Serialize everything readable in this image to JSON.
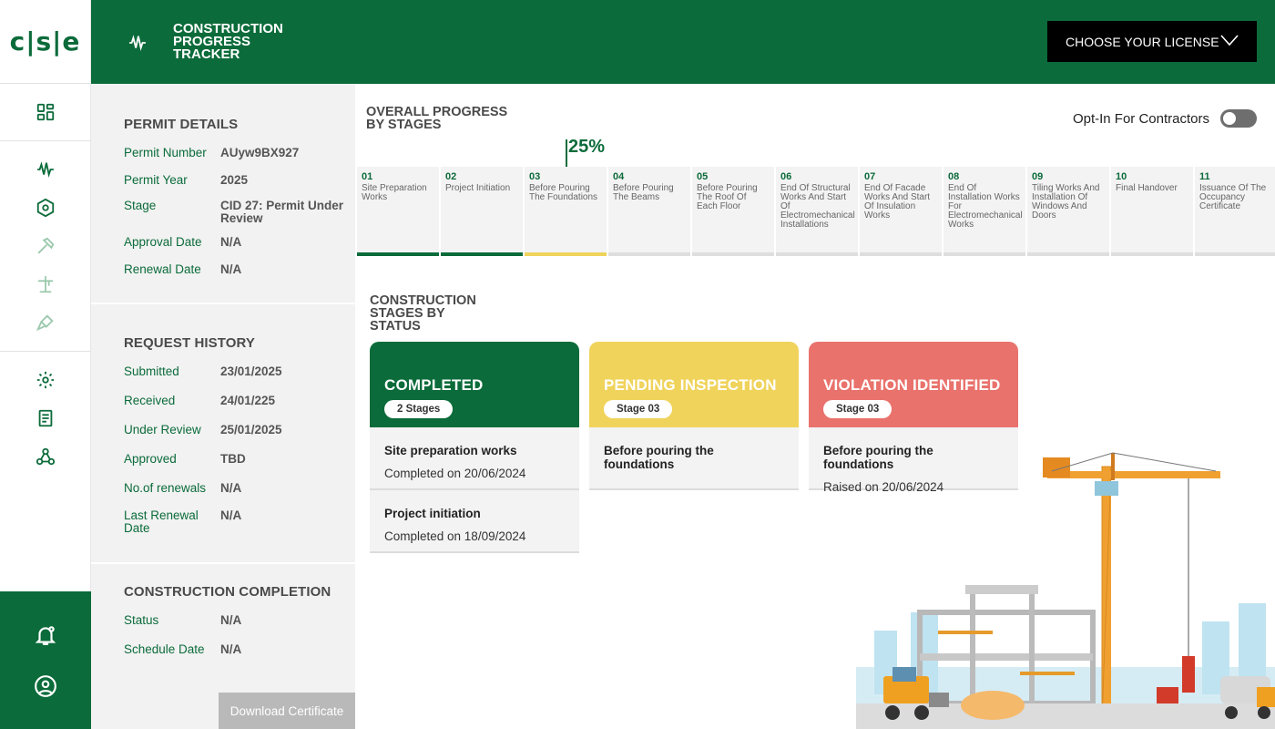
{
  "logo": {
    "text": "c|s|e"
  },
  "header": {
    "title": "CONSTRUCTION PROGRESS TRACKER",
    "license_button": "CHOOSE YOUR LICENSE"
  },
  "permit": {
    "title": "PERMIT DETAILS",
    "rows": [
      {
        "label": "Permit Number",
        "value": "AUyw9BX927"
      },
      {
        "label": "Permit Year",
        "value": "2025"
      },
      {
        "label": "Stage",
        "value": "CID 27: Permit Under Review"
      },
      {
        "label": "Approval Date",
        "value": "N/A"
      },
      {
        "label": "Renewal Date",
        "value": "N/A"
      }
    ]
  },
  "history": {
    "title": "REQUEST HISTORY",
    "rows": [
      {
        "label": "Submitted",
        "value": "23/01/2025"
      },
      {
        "label": "Received",
        "value": "24/01/225"
      },
      {
        "label": "Under Review",
        "value": "25/01/2025"
      },
      {
        "label": "Approved",
        "value": "TBD"
      },
      {
        "label": "No.of renewals",
        "value": "N/A"
      },
      {
        "label": "Last Renewal Date",
        "value": "N/A"
      }
    ]
  },
  "completion": {
    "title": "CONSTRUCTION COMPLETION",
    "rows": [
      {
        "label": "Status",
        "value": "N/A"
      },
      {
        "label": "Schedule Date",
        "value": "N/A"
      }
    ],
    "download_button": "Download Certificate"
  },
  "progress": {
    "title": "OVERALL PROGRESS BY STAGES",
    "percent_label": "25%",
    "percent": 25,
    "optin_label": "Opt-In For Contractors",
    "optin_enabled": false,
    "stages": [
      {
        "num": "01",
        "name": "Site Preparation Works",
        "status": "done"
      },
      {
        "num": "02",
        "name": "Project Initiation",
        "status": "done"
      },
      {
        "num": "03",
        "name": "Before Pouring The Foundations",
        "status": "current"
      },
      {
        "num": "04",
        "name": "Before Pouring The Beams",
        "status": "pending"
      },
      {
        "num": "05",
        "name": "Before Pouring The Roof Of Each Floor",
        "status": "pending"
      },
      {
        "num": "06",
        "name": "End Of Structural Works And Start Of Electromechanical Installations",
        "status": "pending"
      },
      {
        "num": "07",
        "name": "End Of Facade Works And Start Of Insulation Works",
        "status": "pending"
      },
      {
        "num": "08",
        "name": "End Of Installation Works For Electromechanical Works",
        "status": "pending"
      },
      {
        "num": "09",
        "name": "Tiling Works And Installation Of Windows And Doors",
        "status": "pending"
      },
      {
        "num": "10",
        "name": "Final Handover",
        "status": "pending"
      },
      {
        "num": "11",
        "name": "Issuance Of The Occupancy Certificate",
        "status": "pending"
      }
    ]
  },
  "status_section": {
    "title": "CONSTRUCTION STAGES BY STATUS",
    "cards": [
      {
        "name": "COMPLETED",
        "pill": "2 Stages",
        "color": "#0b6b3a",
        "items": [
          {
            "title": "Site preparation works",
            "sub": "Completed on 20/06/2024"
          },
          {
            "title": "Project initiation",
            "sub": "Completed on 18/09/2024"
          }
        ]
      },
      {
        "name": "PENDING INSPECTION",
        "pill": "Stage 03",
        "color": "#f0d35b",
        "items": [
          {
            "title": "Before pouring the foundations",
            "sub": ""
          }
        ]
      },
      {
        "name": "VIOLATION IDENTIFIED",
        "pill": "Stage 03",
        "color": "#e9726c",
        "items": [
          {
            "title": "Before pouring the foundations",
            "sub": "Raised on 20/06/2024"
          }
        ]
      }
    ]
  },
  "colors": {
    "brand": "#0b6b3a",
    "pending": "#f0d35b",
    "violation": "#e9726c"
  }
}
